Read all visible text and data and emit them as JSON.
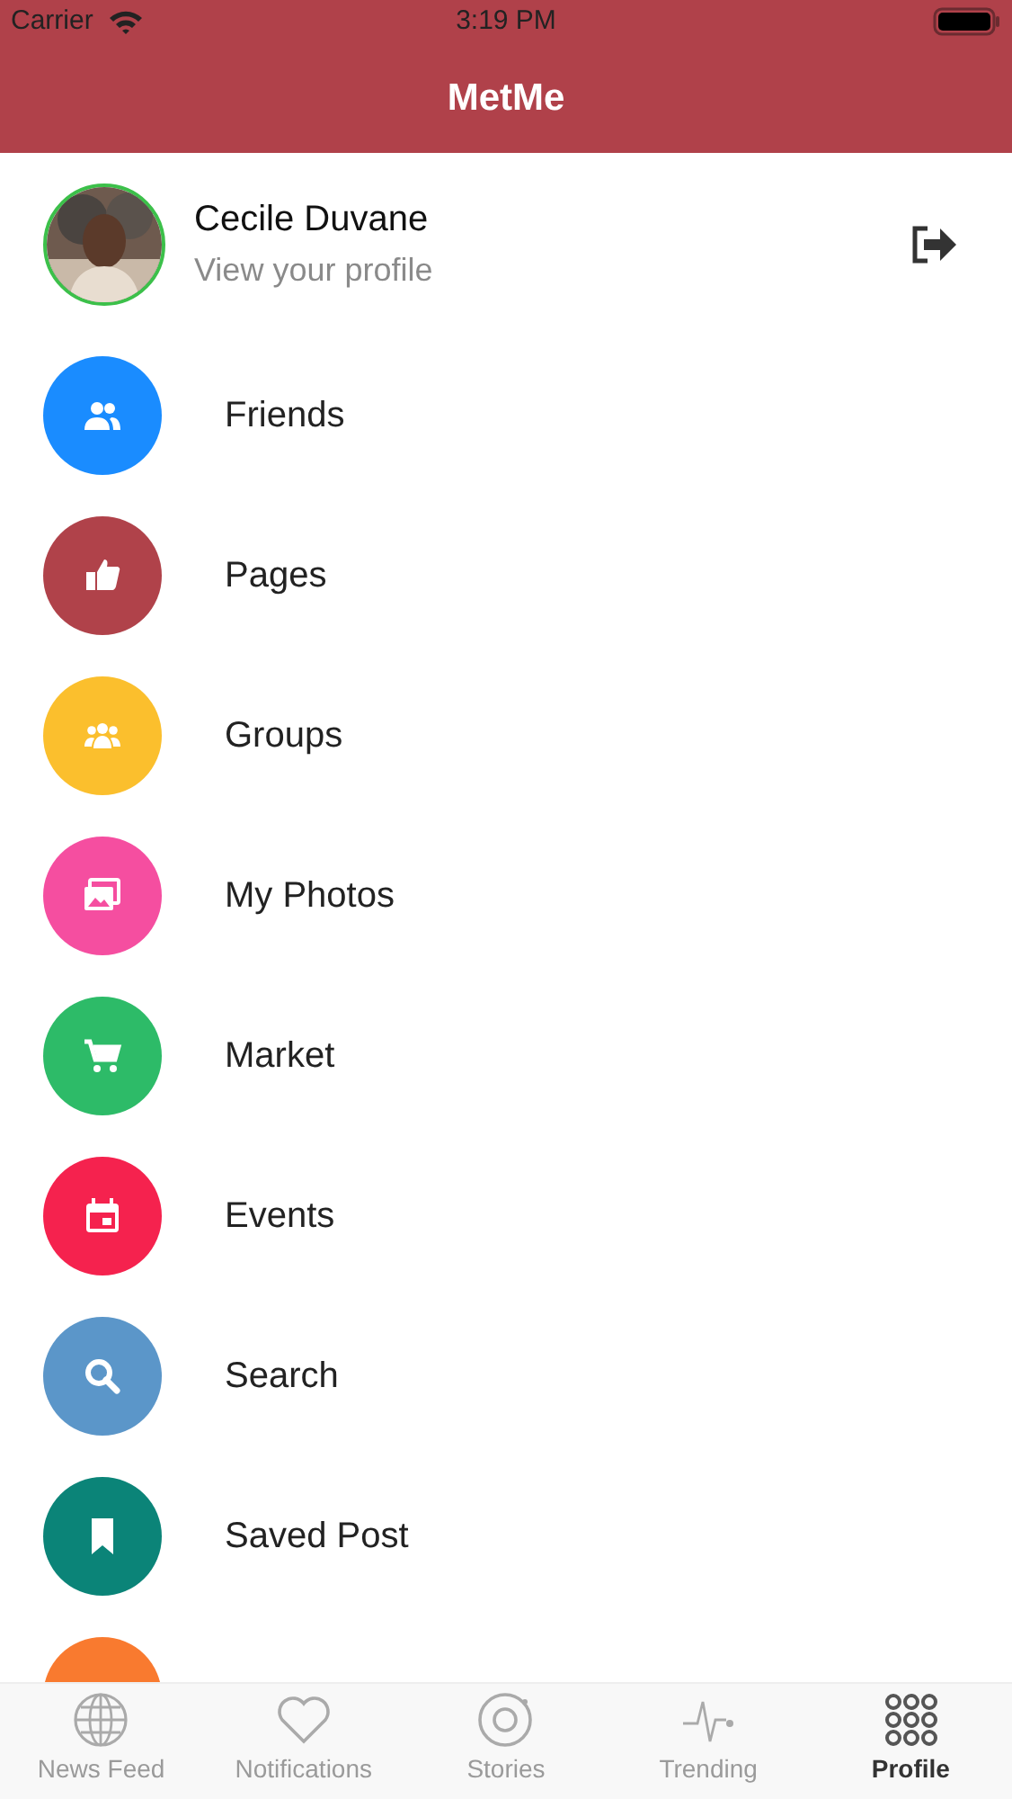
{
  "status_bar": {
    "carrier": "Carrier",
    "time": "3:19 PM"
  },
  "header": {
    "title": "MetMe"
  },
  "profile": {
    "name": "Cecile Duvane",
    "subtitle": "View your profile"
  },
  "menu": [
    {
      "label": "Friends",
      "kind": "people",
      "color": "#1a8cff"
    },
    {
      "label": "Pages",
      "kind": "like",
      "color": "#b0424a"
    },
    {
      "label": "Groups",
      "kind": "group",
      "color": "#fbbf2d"
    },
    {
      "label": "My Photos",
      "kind": "photos",
      "color": "#f54ea0"
    },
    {
      "label": "Market",
      "kind": "cart",
      "color": "#2dbb68"
    },
    {
      "label": "Events",
      "kind": "calendar",
      "color": "#f5224e"
    },
    {
      "label": "Search",
      "kind": "search",
      "color": "#5b96c9"
    },
    {
      "label": "Saved Post",
      "kind": "bookmark",
      "color": "#0b8478"
    },
    {
      "kind": "hidden",
      "color": "#f97a2f"
    }
  ],
  "tab_bar": [
    {
      "label": "News Feed",
      "kind": "globe",
      "selected": false
    },
    {
      "label": "Notifications",
      "kind": "heart",
      "selected": false
    },
    {
      "label": "Stories",
      "kind": "ring",
      "selected": false
    },
    {
      "label": "Trending",
      "kind": "pulse",
      "selected": false
    },
    {
      "label": "Profile",
      "kind": "grid",
      "selected": true
    }
  ]
}
